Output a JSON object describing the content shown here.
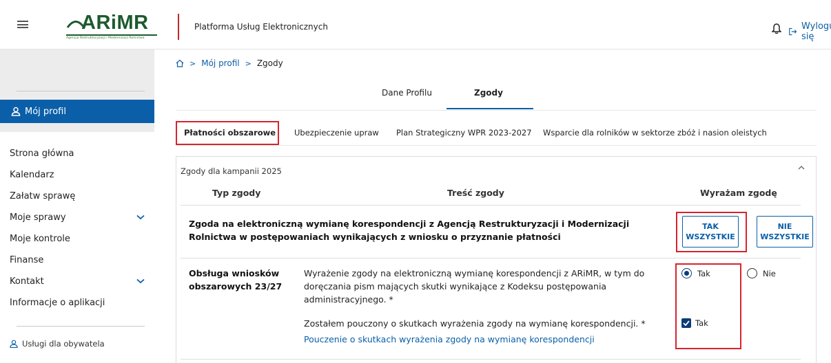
{
  "header": {
    "logo_text": "ARiMR",
    "logo_subtitle": "Agencja Restrukturyzacji i Modernizacji Rolnictwa",
    "platform_title": "Platforma Usług Elektronicznych",
    "logout_label": "Wyloguj się"
  },
  "sidebar": {
    "active_item": "Mój profil",
    "items": [
      {
        "label": "Strona główna",
        "expandable": false
      },
      {
        "label": "Kalendarz",
        "expandable": false
      },
      {
        "label": "Załatw sprawę",
        "expandable": false
      },
      {
        "label": "Moje sprawy",
        "expandable": true
      },
      {
        "label": "Moje kontrole",
        "expandable": false
      },
      {
        "label": "Finanse",
        "expandable": false
      },
      {
        "label": "Kontakt",
        "expandable": true
      },
      {
        "label": "Informacje o aplikacji",
        "expandable": false
      }
    ],
    "bottom_link": "Usługi dla obywatela"
  },
  "breadcrumb": {
    "sep": ">",
    "link": "Mój profil",
    "current": "Zgody"
  },
  "tabs_top": [
    "Dane Profilu",
    "Zgody"
  ],
  "tabs_sub": [
    "Płatności obszarowe",
    "Ubezpieczenie upraw",
    "Plan Strategiczny WPR 2023-2027",
    "Wsparcie dla rolników w sektorze zbóż i nasion oleistych"
  ],
  "panel": {
    "title": "Zgody dla kampanii 2025",
    "col_type": "Typ zgody",
    "col_content": "Treść zgody",
    "col_agree": "Wyrażam zgodę",
    "main_consent": "Zgoda na elektroniczną wymianę korespondencji z Agencją Restrukturyzacji i Modernizacji Rolnictwa w postępowaniach wynikających z wniosku o przyznanie płatności",
    "btn_yes_all_line1": "TAK",
    "btn_yes_all_line2": "WSZYSTKIE",
    "btn_no_all_line1": "NIE",
    "btn_no_all_line2": "WSZYSTKIE",
    "section_label_line1": "Obsługa wniosków",
    "section_label_line2": "obszarowych 23/27",
    "consent1": "Wyrażenie zgody na elektroniczną wymianę korespondencji z ARiMR, w tym do doręczania pism mających skutki wynikające z Kodeksu postępowania administracyjnego. *",
    "consent1_yes": "Tak",
    "consent1_no": "Nie",
    "consent2": "Zostałem pouczony o skutkach wyrażenia zgody na wymianę korespondencji. *",
    "consent2_check": "Tak",
    "link": "Pouczenie o skutkach wyrażenia zgody na wymianę korespondencji"
  },
  "colors": {
    "primary": "#0a5fa8",
    "highlight": "#d7232e",
    "logo_green": "#1d5a2e"
  }
}
